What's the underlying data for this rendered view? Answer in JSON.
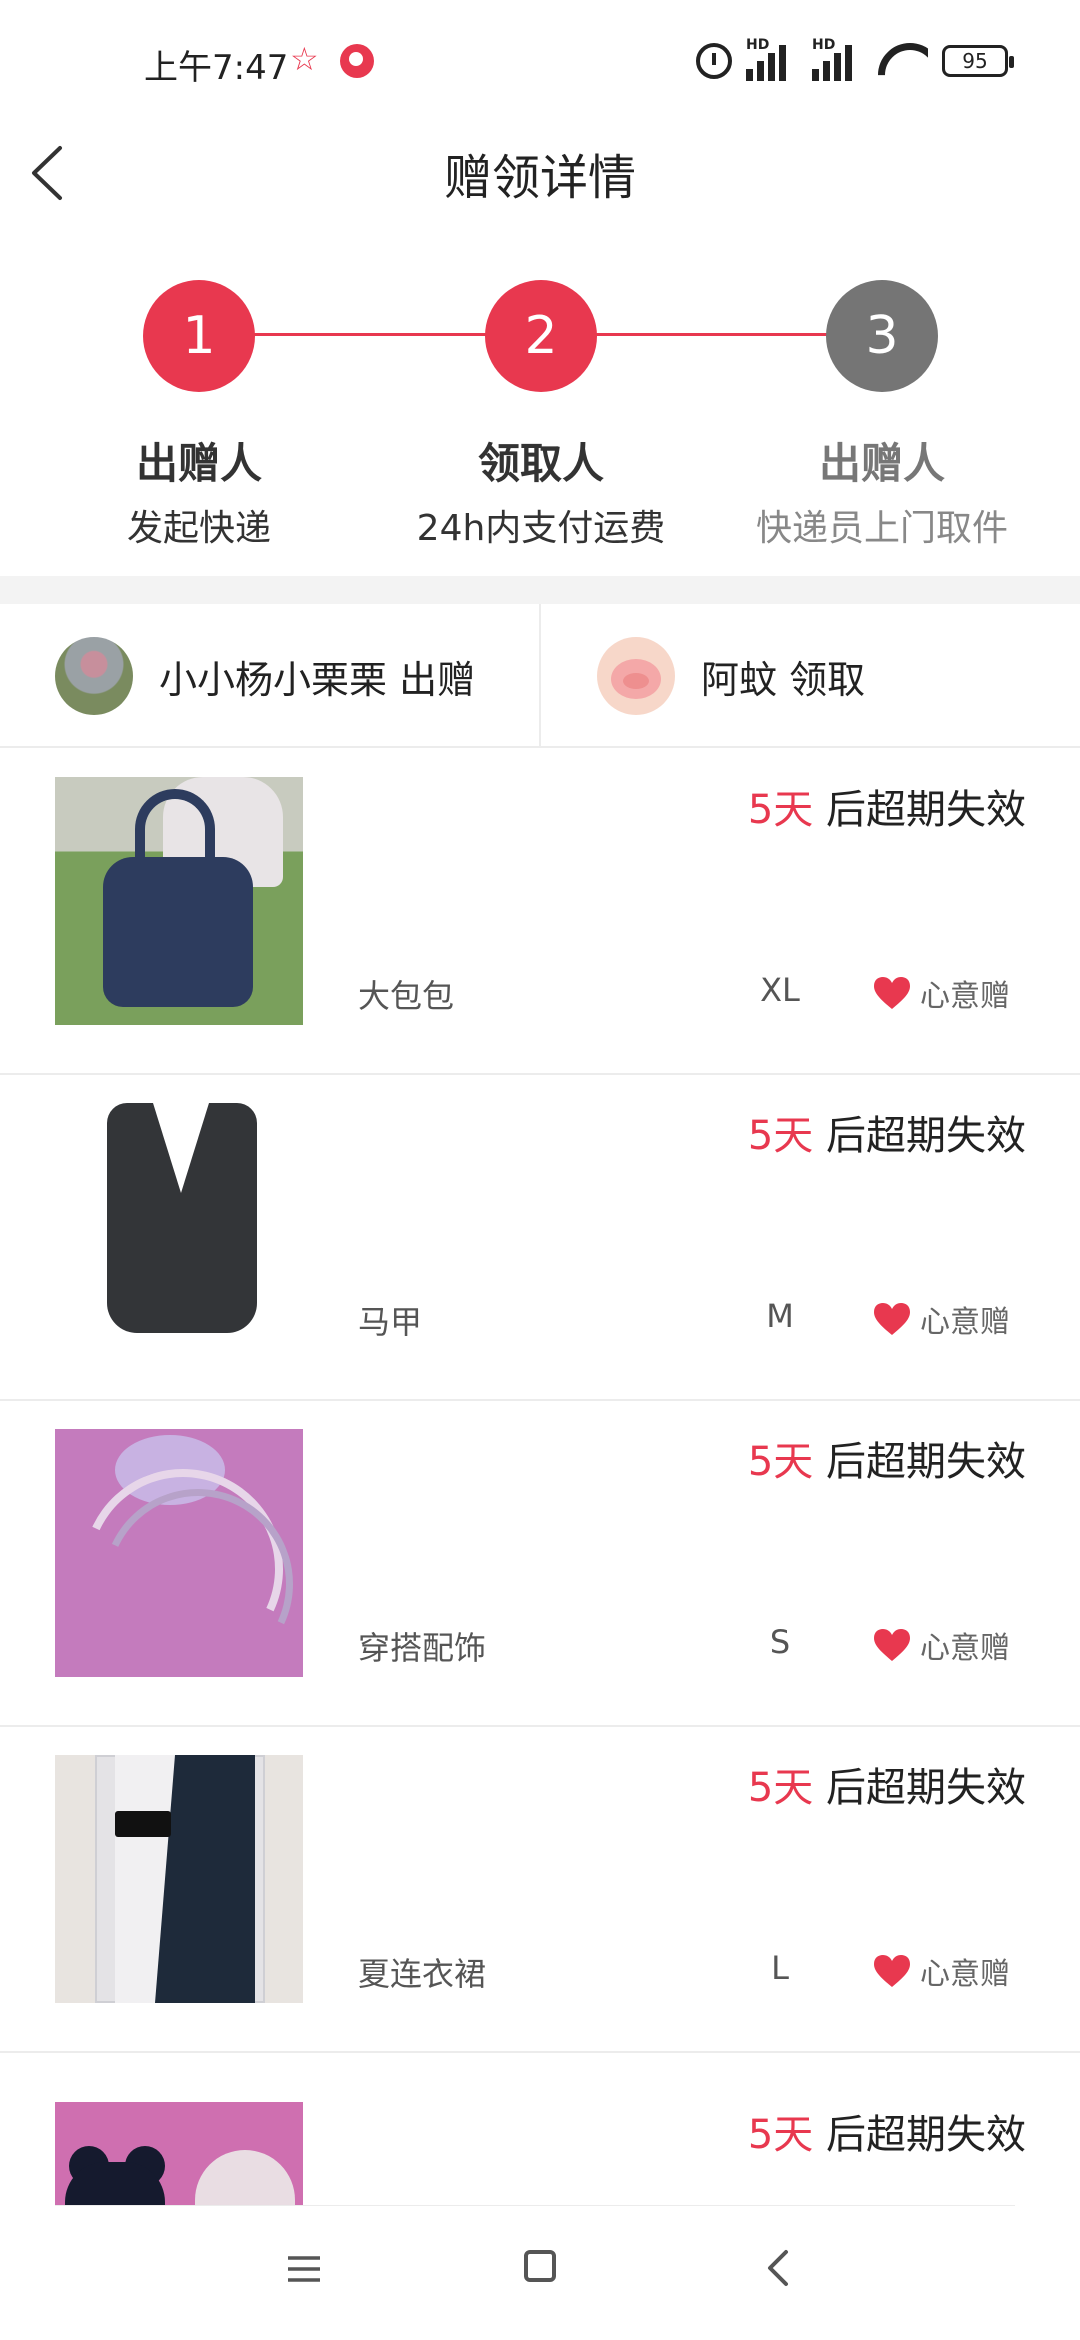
{
  "status_bar": {
    "time": "上午7:47",
    "battery": "95",
    "icons": [
      "star-icon",
      "app-icon",
      "alarm-icon",
      "signal-hd-icon",
      "signal-hd-icon",
      "wifi-icon",
      "battery-icon"
    ],
    "signal_label": "HD"
  },
  "nav": {
    "title": "赠领详情",
    "back_icon": "chevron-left-icon"
  },
  "steps": [
    {
      "number": "1",
      "title": "出赠人",
      "subtitle": "发起快递",
      "status": "active"
    },
    {
      "number": "2",
      "title": "领取人",
      "subtitle": "24h内支付运费",
      "status": "active"
    },
    {
      "number": "3",
      "title": "出赠人",
      "subtitle": "快递员上门取件",
      "status": "pending"
    }
  ],
  "parties": {
    "giver": "小小杨小栗栗 出赠",
    "receiver": "阿蚊 领取"
  },
  "items": [
    {
      "days": "5天",
      "expire_suffix": " 后超期失效",
      "name": "大包包",
      "size": "XL",
      "gift_label": "心意赠"
    },
    {
      "days": "5天",
      "expire_suffix": " 后超期失效",
      "name": "马甲",
      "size": "M",
      "gift_label": "心意赠"
    },
    {
      "days": "5天",
      "expire_suffix": " 后超期失效",
      "name": "穿搭配饰",
      "size": "S",
      "gift_label": "心意赠"
    },
    {
      "days": "5天",
      "expire_suffix": " 后超期失效",
      "name": "夏连衣裙",
      "size": "L",
      "gift_label": "心意赠"
    },
    {
      "days": "5天",
      "expire_suffix": " 后超期失效"
    }
  ],
  "colors": {
    "accent": "#e8384f",
    "pending": "#757575",
    "divider": "#ececec"
  },
  "system_nav": [
    "menu-icon",
    "home-icon",
    "back-icon"
  ]
}
